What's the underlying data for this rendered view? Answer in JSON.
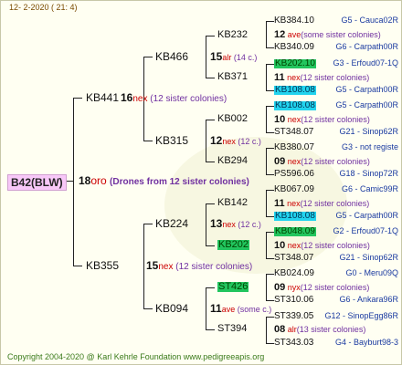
{
  "header": "12-  2-2020 (  21:  4)",
  "footer": "Copyright 2004-2020 @ Karl Kehrle Foundation    www.pedigreeapis.org",
  "root": {
    "id": "B42(BLW)",
    "num": "18",
    "breed": "oro",
    "note": "(Drones from 12 sister colonies)"
  },
  "gen1": [
    {
      "id": "KB441",
      "num": "16",
      "breed": "nex",
      "note": "(12 sister colonies)"
    },
    {
      "id": "KB355",
      "num": "15",
      "breed": "nex",
      "note": "(12 sister colonies)"
    }
  ],
  "gen2": [
    {
      "id": "KB466",
      "num": "15",
      "breed": "alr",
      "note": "(14 c.)"
    },
    {
      "id": "KB315",
      "num": "12",
      "breed": "nex",
      "note": "(12 c.)"
    },
    {
      "id": "KB224",
      "num": "13",
      "breed": "nex",
      "note": "(12 c.)"
    },
    {
      "id": "KB094",
      "num": "11",
      "breed": "ave",
      "note": "(some c.)"
    }
  ],
  "gen3": [
    {
      "id": "KB232",
      "num": "12",
      "breed": "ave",
      "note": "(some sister colonies)"
    },
    {
      "id": "KB371",
      "num": "11",
      "breed": "nex",
      "note": "(12 sister colonies)"
    },
    {
      "id": "KB002",
      "num": "10",
      "breed": "nex",
      "note": "(12 sister colonies)"
    },
    {
      "id": "KB294",
      "num": "09",
      "breed": "nex",
      "note": "(12 sister colonies)"
    },
    {
      "id": "KB142",
      "num": "11",
      "breed": "nex",
      "note": "(12 sister colonies)"
    },
    {
      "id": "KB202",
      "num": "10",
      "breed": "nex",
      "note": "(12 sister colonies)"
    },
    {
      "id": "ST426",
      "num": "09",
      "breed": "nyx",
      "note": "(12 sister colonies)"
    },
    {
      "id": "ST394",
      "num": "08",
      "breed": "alr",
      "note": "(13 sister colonies)"
    }
  ],
  "gen4": [
    {
      "id": "KB384.10",
      "loc": "G5 - Cauca02R"
    },
    {
      "id": "KB340.09",
      "loc": "G6 - Carpath00R"
    },
    {
      "id": "KB202.10",
      "loc": "G3 - Erfoud07-1Q"
    },
    {
      "id": "KB108.08",
      "loc": "G5 - Carpath00R"
    },
    {
      "id": "KB108.08",
      "loc": "G5 - Carpath00R"
    },
    {
      "id": "ST348.07",
      "loc": "G21 - Sinop62R"
    },
    {
      "id": "KB380.07",
      "loc": "G3 - not registe"
    },
    {
      "id": "PS596.06",
      "loc": "G18 - Sinop72R"
    },
    {
      "id": "KB067.09",
      "loc": "G6 - Camic99R"
    },
    {
      "id": "KB108.08",
      "loc": "G5 - Carpath00R"
    },
    {
      "id": "KB048.09",
      "loc": "G2 - Erfoud07-1Q"
    },
    {
      "id": "ST348.07",
      "loc": "G21 - Sinop62R"
    },
    {
      "id": "KB024.09",
      "loc": "G0 - Meru09Q"
    },
    {
      "id": "ST310.06",
      "loc": "G6 - Ankara96R"
    },
    {
      "id": "ST339.05",
      "loc": "G12 - SinopEgg86R"
    },
    {
      "id": "ST343.03",
      "loc": "G4 - Bayburt98-3"
    }
  ]
}
